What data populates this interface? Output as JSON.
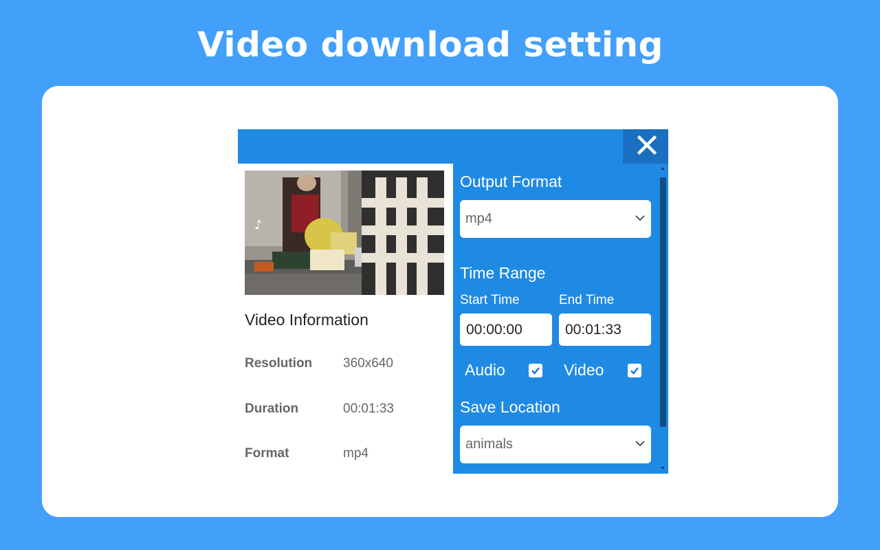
{
  "banner": {
    "title": "Video download setting"
  },
  "dialog": {
    "close_icon": "close-icon",
    "video_info": {
      "heading": "Video Information",
      "rows": [
        {
          "label": "Resolution",
          "value": "360x640"
        },
        {
          "label": "Duration",
          "value": "00:01:33"
        },
        {
          "label": "Format",
          "value": "mp4"
        }
      ]
    },
    "settings": {
      "output_format_label": "Output Format",
      "output_format_value": "mp4",
      "time_range_label": "Time Range",
      "start_time_label": "Start Time",
      "start_time_value": "00:00:00",
      "end_time_label": "End Time",
      "end_time_value": "00:01:33",
      "audio_label": "Audio",
      "audio_checked": true,
      "video_label": "Video",
      "video_checked": true,
      "save_location_label": "Save Location",
      "save_location_value": "animals"
    }
  },
  "colors": {
    "background": "#42a0fb",
    "panel_blue": "#1f8ae3",
    "close_bg": "#1a6fc0",
    "checkbox_check": "#1a73e8"
  }
}
